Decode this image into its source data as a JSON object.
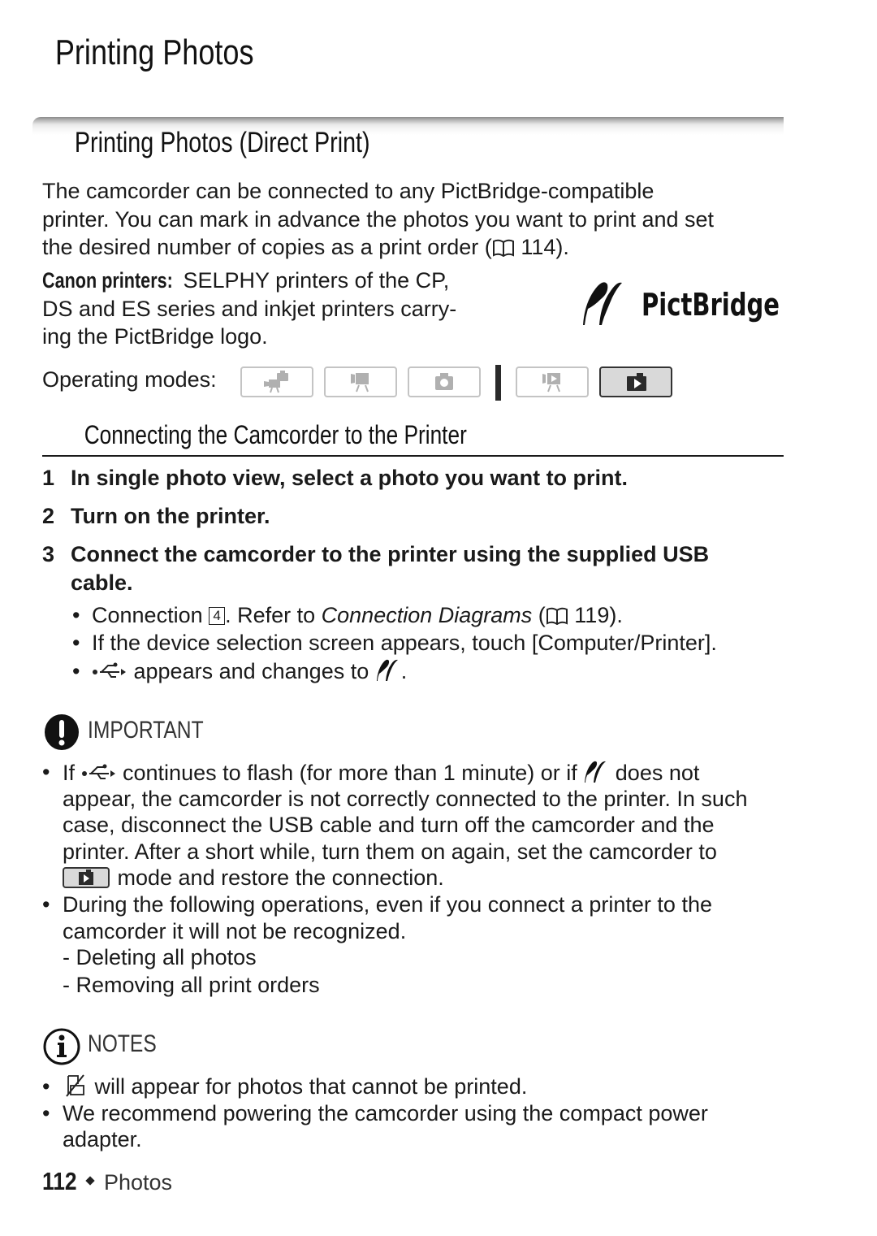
{
  "page": {
    "title": "Printing Photos",
    "section_title": "Printing Photos (Direct Print)",
    "intro": {
      "line1": "The camcorder can be connected to any PictBridge-compatible",
      "line2": "printer. You can mark in advance the photos you want to print and set",
      "line3_pre": "the desired number of copies as a print order (",
      "line3_ref": "114",
      "line3_post": ")."
    },
    "canon": {
      "label": "Canon printers:",
      "line1": " SELPHY printers of the CP,",
      "line2": "DS and ES series and inkjet printers carry-",
      "line3": "ing the PictBridge logo."
    },
    "pictbridge_logo": {
      "icon": "pictbridge-logo",
      "text": "PictBridge"
    },
    "operating_modes": {
      "label": "Operating modes:",
      "modes": [
        {
          "icon": "auto-movie-photo-mode-icon",
          "active": false
        },
        {
          "icon": "movie-record-mode-icon",
          "active": false
        },
        {
          "icon": "photo-record-mode-icon",
          "active": false
        },
        {
          "icon": "movie-playback-mode-icon",
          "active": false
        },
        {
          "icon": "photo-playback-mode-icon",
          "active": true
        }
      ]
    },
    "subsection_title": "Connecting the Camcorder to the Printer",
    "steps": [
      {
        "num": "1",
        "text": "In single photo view, select a photo you want to print."
      },
      {
        "num": "2",
        "text": "Turn on the printer."
      },
      {
        "num": "3",
        "text": "Connect the camcorder to the printer using the supplied USB cable."
      }
    ],
    "step3_bullets": {
      "b1_pre": "Connection ",
      "b1_box": "4",
      "b1_mid": ". Refer to ",
      "b1_italic": "Connection Diagrams",
      "b1_ref_pre": " (",
      "b1_ref": "119",
      "b1_post": ").",
      "b2": "If the device selection screen appears, touch [Computer/Printer].",
      "b3_mid": " appears and changes to ",
      "b3_post": "."
    },
    "important": {
      "heading": "IMPORTANT",
      "p1_l1_pre": "If ",
      "p1_l1_mid": " continues to flash (for more than 1 minute) or if ",
      "p1_l1_post": " does not",
      "p1_l2": "appear, the camcorder is not correctly connected to the printer. In such",
      "p1_l3": "case, disconnect the USB cable and turn off the camcorder and the",
      "p1_l4": "printer. After a short while, turn them on again, set the camcorder to",
      "p1_l5": " mode and restore the connection.",
      "p2_l1": "During the following operations, even if you connect a printer to the",
      "p2_l2": "camcorder it will not be recognized.",
      "dash1": "- Deleting all photos",
      "dash2": "- Removing all print orders"
    },
    "notes": {
      "heading": "NOTES",
      "n1": " will appear for photos that cannot be printed.",
      "n2_l1": "We recommend powering the camcorder using the compact power",
      "n2_l2": "adapter."
    },
    "footer": {
      "page_number": "112",
      "section": "Photos"
    },
    "bullet_char": "•"
  }
}
